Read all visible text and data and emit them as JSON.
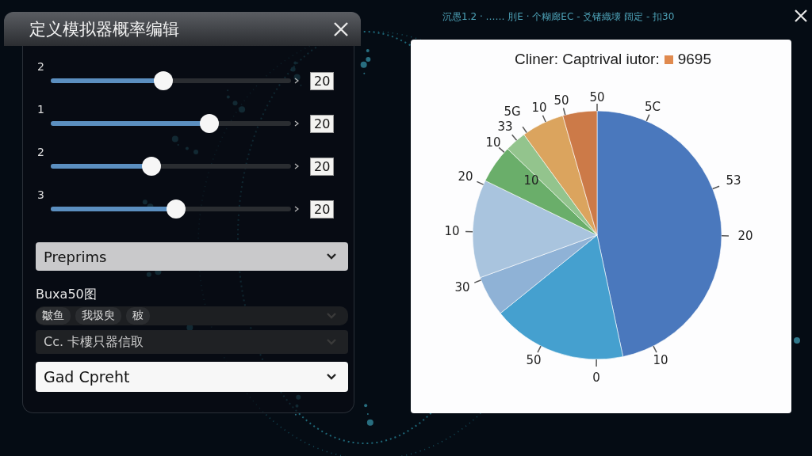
{
  "dialog": {
    "title": "定义模拟器概率编辑",
    "sliders": [
      {
        "label": "2",
        "level": 0.47,
        "value": "20"
      },
      {
        "label": "1",
        "level": 0.66,
        "value": "20"
      },
      {
        "label": "2",
        "level": 0.42,
        "value": "20"
      },
      {
        "label": "3",
        "level": 0.52,
        "value": "20"
      }
    ],
    "preset_dropdown": {
      "value": "Preprims"
    },
    "section_label": "Buxa50图",
    "chips": [
      "皺鱼",
      "我圾臾",
      "秛"
    ],
    "source_dropdown": {
      "value": "Cc. 卡樓只器信取"
    },
    "mode_dropdown": {
      "value": "Gad Cpreht"
    }
  },
  "header_text": "沉愚1.2 · …… 刖E · 个糊廊EC - 爻锗織壊 阔定 - 扣30",
  "chart_card": {
    "title": "Cliner: Captrival iutor:",
    "legend": {
      "color": "#e08a4f",
      "label": "9695"
    },
    "dial_labels": [
      "50",
      "5C",
      "53",
      "20",
      "10",
      "0",
      "50",
      "30",
      "10",
      "20",
      "10",
      "10",
      "33",
      "5G",
      "10",
      "50"
    ]
  }
}
